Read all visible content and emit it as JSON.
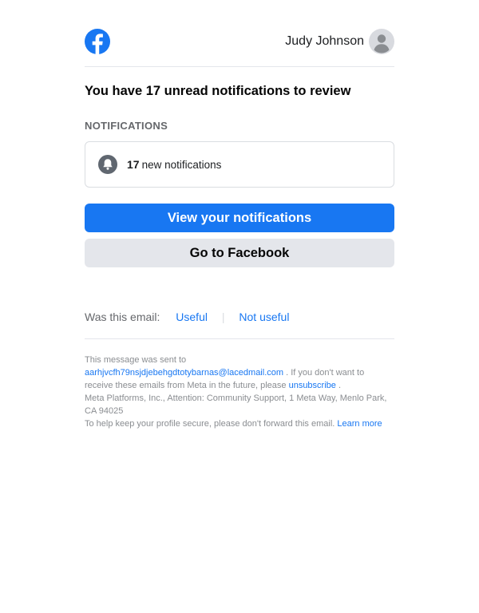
{
  "header": {
    "user_name": "Judy Johnson"
  },
  "headline": "You have 17 unread notifications to review",
  "section_label": "NOTIFICATIONS",
  "notification_card": {
    "count": "17",
    "text": "new notifications"
  },
  "buttons": {
    "view_label": "View your notifications",
    "facebook_label": "Go to Facebook"
  },
  "feedback": {
    "question": "Was this email:",
    "useful": "Useful",
    "separator": "|",
    "not_useful": "Not useful"
  },
  "footer": {
    "sent_to": "This message was sent to",
    "email": "aarhjvcfh79nsjdjebehgdtotybarnas@lacedmail.com",
    "unsubscribe_pre": ". If you don't want to receive these emails from Meta in the future, please",
    "unsubscribe": "unsubscribe",
    "unsubscribe_post": ".",
    "address": "Meta Platforms, Inc., Attention: Community Support, 1 Meta Way, Menlo Park, CA 94025",
    "secure_text": "To help keep your profile secure, please don't forward this email.",
    "learn_more": "Learn more"
  },
  "colors": {
    "brand_blue": "#1877f2",
    "secondary_button": "#e4e6eb",
    "muted_text": "#65676b"
  },
  "icons": [
    "facebook-logo-icon",
    "avatar-icon",
    "bell-icon"
  ]
}
